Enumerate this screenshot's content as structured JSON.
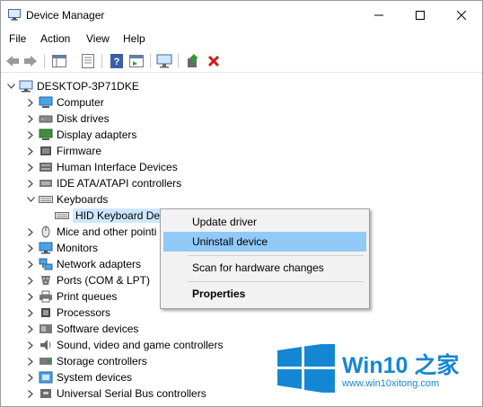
{
  "window": {
    "title": "Device Manager"
  },
  "menu": [
    "File",
    "Action",
    "View",
    "Help"
  ],
  "tree": {
    "root": "DESKTOP-3P71DKE",
    "items": [
      {
        "label": "Computer",
        "icon": "computer-icon"
      },
      {
        "label": "Disk drives",
        "icon": "disk-drive-icon"
      },
      {
        "label": "Display adapters",
        "icon": "display-adapter-icon"
      },
      {
        "label": "Firmware",
        "icon": "firmware-icon"
      },
      {
        "label": "Human Interface Devices",
        "icon": "hid-icon"
      },
      {
        "label": "IDE ATA/ATAPI controllers",
        "icon": "ide-controller-icon"
      },
      {
        "label": "Keyboards",
        "icon": "keyboard-icon",
        "expanded": true
      },
      {
        "label": "HID Keyboard Device",
        "icon": "keyboard-icon",
        "child": true,
        "selected": true
      },
      {
        "label": "Mice and other pointing devices",
        "icon": "mouse-icon"
      },
      {
        "label": "Monitors",
        "icon": "monitor-icon"
      },
      {
        "label": "Network adapters",
        "icon": "network-icon"
      },
      {
        "label": "Ports (COM & LPT)",
        "icon": "port-icon"
      },
      {
        "label": "Print queues",
        "icon": "printer-icon"
      },
      {
        "label": "Processors",
        "icon": "processor-icon"
      },
      {
        "label": "Software devices",
        "icon": "software-device-icon"
      },
      {
        "label": "Sound, video and game controllers",
        "icon": "sound-icon"
      },
      {
        "label": "Storage controllers",
        "icon": "storage-icon"
      },
      {
        "label": "System devices",
        "icon": "system-device-icon"
      },
      {
        "label": "Universal Serial Bus controllers",
        "icon": "usb-icon"
      }
    ]
  },
  "visible_labels": {
    "hid_keyboard": "HID Keyboard Dev",
    "mice": "Mice and other pointi"
  },
  "context_menu": {
    "update": "Update driver",
    "uninstall": "Uninstall device",
    "scan": "Scan for hardware changes",
    "properties": "Properties"
  },
  "watermark": {
    "brand": "Win10 之家",
    "url": "www.win10xitong.com"
  },
  "colors": {
    "selection": "#cce8ff",
    "menu_highlight": "#91c9f7",
    "logo_blue": "#1487d4"
  }
}
